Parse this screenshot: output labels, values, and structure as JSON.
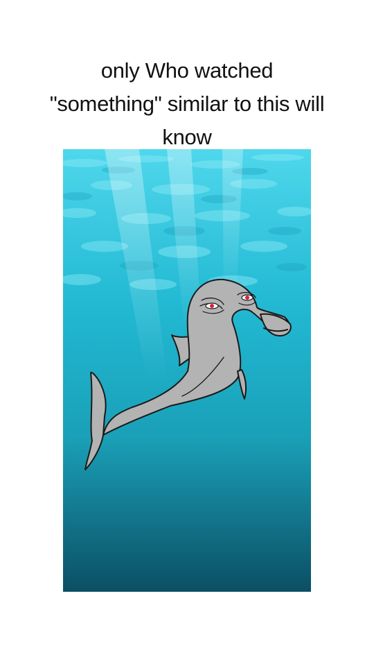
{
  "caption": {
    "line1": "only Who watched",
    "line2": "\"something\" similar to this will",
    "line3": "know"
  },
  "scene": {
    "water_top_color": "#4fd7ec",
    "water_mid_color": "#1aa8c2",
    "water_bottom_color": "#0b4f63",
    "dolphin_color": "#b3b3b3",
    "outline_color": "#1a1a1a",
    "eye_color": "#d9203a",
    "subject_icon": "dolphin-illustration"
  }
}
